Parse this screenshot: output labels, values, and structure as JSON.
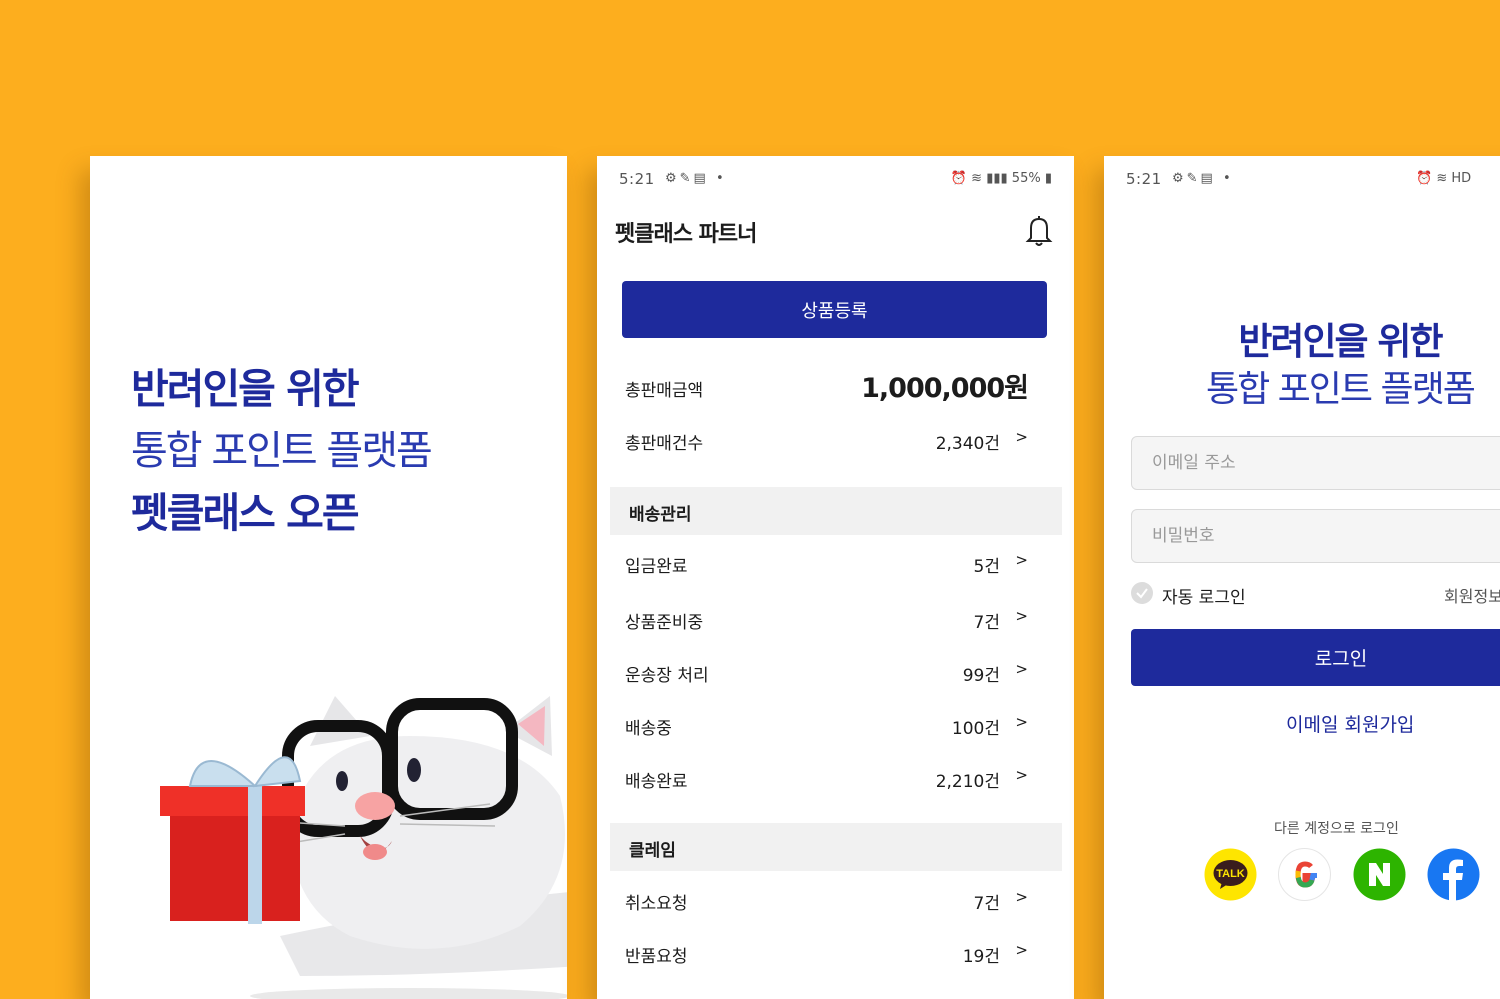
{
  "screen1": {
    "promo": {
      "line1": "반려인을 위한",
      "line2": "통합 포인트 플랫폼",
      "line3": "펫클래스 오픈"
    }
  },
  "status": {
    "time": "5:21",
    "battery": "55%"
  },
  "screen2": {
    "title": "펫클래스 파트너",
    "register_button": "상품등록",
    "total_sales_amount": {
      "label": "총판매금액",
      "value": "1,000,000원"
    },
    "total_sales_count": {
      "label": "총판매건수",
      "value": "2,340건"
    },
    "chevron": ">",
    "delivery": {
      "header": "배송관리",
      "items": [
        {
          "label": "입금완료",
          "value": "5건"
        },
        {
          "label": "상품준비중",
          "value": "7건"
        },
        {
          "label": "운송장 처리",
          "value": "99건"
        },
        {
          "label": "배송중",
          "value": "100건"
        },
        {
          "label": "배송완료",
          "value": "2,210건"
        }
      ]
    },
    "claim": {
      "header": "클레임",
      "items": [
        {
          "label": "취소요청",
          "value": "7건"
        },
        {
          "label": "반품요청",
          "value": "19건"
        }
      ]
    }
  },
  "screen3": {
    "hero": {
      "line1": "반려인을 위한",
      "line2": "통합 포인트 플랫폼"
    },
    "email_placeholder": "이메일 주소",
    "password_placeholder": "비밀번호",
    "auto_login": "자동 로그인",
    "signup_find": "회원정보",
    "login_button": "로그인",
    "email_signup": "이메일 회원가입",
    "other_login": "다른 계정으로 로그인",
    "social": {
      "kakao_label": "TALK"
    },
    "colors": {
      "primary": "#1E2A9C",
      "kakao": "#FEE500",
      "naver": "#2DB400",
      "facebook": "#1877F2"
    }
  }
}
